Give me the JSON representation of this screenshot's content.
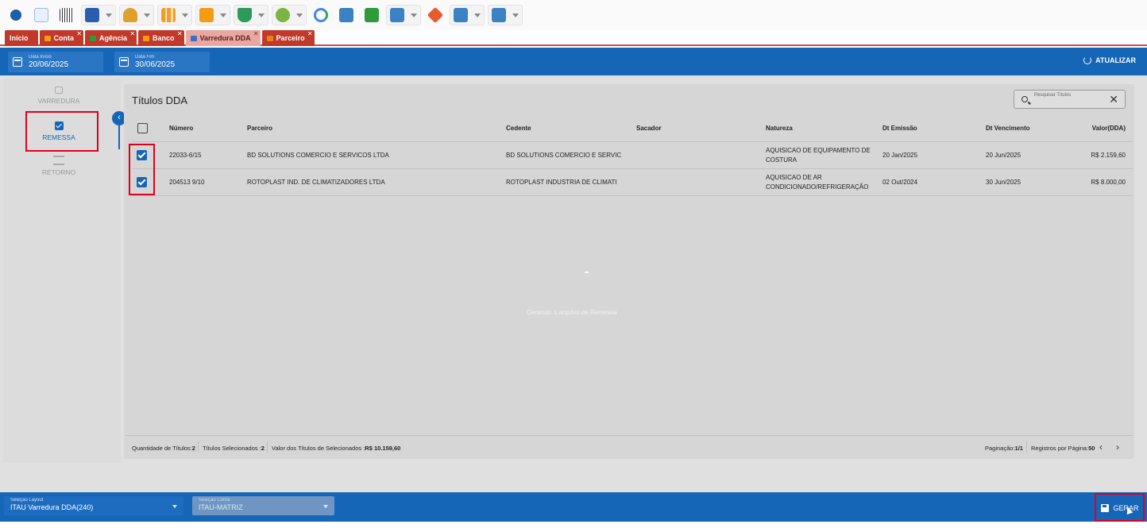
{
  "toolbar": {
    "buttons": [
      {
        "name": "globe-icon",
        "color": "#1d5fa8"
      },
      {
        "name": "sisdepro-logo",
        "color": "#3a7bd5"
      },
      {
        "name": "barcode-icon",
        "color": "#333333"
      },
      {
        "name": "settings-icon",
        "color": "#2a5db0"
      },
      {
        "name": "people-icon",
        "color": "#e0a02c"
      },
      {
        "name": "bar-chart-icon",
        "color": "#f0a020"
      },
      {
        "name": "box-icon",
        "color": "#f39c12"
      },
      {
        "name": "cart-icon",
        "color": "#2e9a5a"
      },
      {
        "name": "shield-icon",
        "color": "#7cb342"
      },
      {
        "name": "google-icon",
        "color": "#4285f4"
      },
      {
        "name": "documents-icon",
        "color": "#3b82c4"
      },
      {
        "name": "save-icon",
        "color": "#2e9a3a"
      },
      {
        "name": "window-icon",
        "color": "#3b82c4"
      },
      {
        "name": "tag-icon",
        "color": "#e65c2e"
      },
      {
        "name": "window-icon",
        "color": "#3b82c4"
      },
      {
        "name": "window-icon",
        "color": "#3b82c4"
      }
    ]
  },
  "tabs": [
    {
      "label": "Início",
      "closable": false,
      "active": false
    },
    {
      "label": "Conta",
      "closable": true,
      "active": false
    },
    {
      "label": "Agência",
      "closable": true,
      "active": false
    },
    {
      "label": "Banco",
      "closable": true,
      "active": false
    },
    {
      "label": "Varredura DDA",
      "closable": true,
      "active": true
    },
    {
      "label": "Parceiro",
      "closable": true,
      "active": false
    }
  ],
  "header": {
    "date_start": {
      "label": "Data Início",
      "value": "20/06/2025"
    },
    "date_end": {
      "label": "Data Fim",
      "value": "30/06/2025"
    },
    "refresh_label": "ATUALIZAR"
  },
  "nav": {
    "varredura": "VARREDURA",
    "remessa": "REMESSA",
    "retorno": "RETORNO"
  },
  "table": {
    "title": "Títulos DDA",
    "search_placeholder": "Pesquisar Títulos",
    "columns": [
      "Número",
      "Parceiro",
      "Cedente",
      "Sacador",
      "Natureza",
      "Dt Emissão",
      "Dt Vencimento",
      "Valor(DDA)"
    ],
    "rows": [
      {
        "numero": "22033-6/15",
        "parceiro": "BD SOLUTIONS COMERCIO E SERVICOS LTDA",
        "cedente": "BD SOLUTIONS COMERCIO E SERVIC",
        "sacador": "",
        "natureza_1": "AQUISICAO DE EQUIPAMENTO DE",
        "natureza_2": "COSTURA",
        "dt_emissao": "20 Jan/2025",
        "dt_vencimento": "20 Jun/2025",
        "valor": "R$ 2.159,60",
        "checked": true
      },
      {
        "numero": "204513 9/10",
        "parceiro": "ROTOPLAST IND. DE CLIMATIZADORES LTDA",
        "cedente": "ROTOPLAST INDUSTRIA DE CLIMATI",
        "sacador": "",
        "natureza_1": "AQUISICAO DE AR",
        "natureza_2": "CONDICIONADO/REFRIGERAÇÃO",
        "dt_emissao": "02 Out/2024",
        "dt_vencimento": "30 Jun/2025",
        "valor": "R$ 8.000,00",
        "checked": true
      }
    ],
    "loading_text": "Gerando o arquivo de Remessa"
  },
  "footer": {
    "qtd_label": "Quantidade de Títulos:",
    "qtd_value": "2",
    "sel_label": "Títulos Selecionados :",
    "sel_value": "2",
    "valor_label": "Valor dos Títulos de Selecionados :",
    "valor_value": "R$ 10.159,60",
    "pag_label": "Paginação:",
    "pag_value": "1/1",
    "reg_label": "Registros por Página:",
    "reg_value": "50"
  },
  "bottom": {
    "layout_label": "Seleção Layout",
    "layout_value": "ITAU Varredura DDA(240)",
    "conta_label": "Seleção Conta",
    "conta_value": "ITAU-MATRIZ",
    "gerar_label": "GERAR"
  },
  "colors": {
    "primary": "#1666b8",
    "tab_red": "#c0392b",
    "highlight_red": "#e0001b"
  }
}
